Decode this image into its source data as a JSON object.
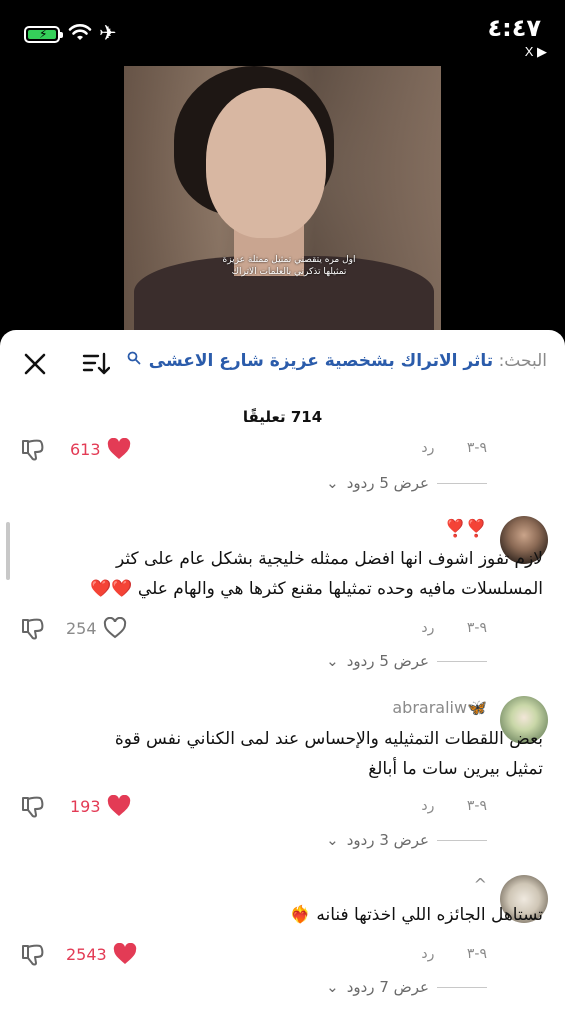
{
  "status_bar": {
    "time": "٤:٤٧",
    "back_app": "X ▶",
    "battery_icon": "battery-charging-icon",
    "wifi_icon": "wifi-icon",
    "airplane_icon": "airplane-icon"
  },
  "video": {
    "caption": "اول مره يتقصني تمثيل ممثلة عزيزة تمثيلها تذكرني بالعلمات الاتراك"
  },
  "search_bar": {
    "label": "البحث:",
    "query": "تاثر الاتراك بشخصية عزيزة شارع الاعشى",
    "close_icon": "close-icon",
    "sort_icon": "sort-icon",
    "search_icon": "search-icon"
  },
  "comments_count": "714 تعليقًا",
  "comments": [
    {
      "date": "٩-٣",
      "reply_label": "رد",
      "likes": "613",
      "liked": true,
      "view_replies": "عرض 5 ردود"
    },
    {
      "username": "",
      "prefix_emoji": "❣️❣️",
      "text": "لازم تفوز اشوف انها افضل ممثله خليجية بشكل عام على كثر المسلسلات مافيه وحده تمثيلها مقنع كثرها هي والهام علي ❤️❤️",
      "date": "٩-٣",
      "reply_label": "رد",
      "likes": "254",
      "liked": false,
      "view_replies": "عرض 5 ردود"
    },
    {
      "username": "abraraliw🦋",
      "text": "بعض اللقطات التمثيليه والإحساس عند لمى الكناني نفس قوة تمثيل بيرين سات ما أبالغ",
      "date": "٩-٣",
      "reply_label": "رد",
      "likes": "193",
      "liked": true,
      "view_replies": "عرض 3 ردود"
    },
    {
      "username": "^",
      "text": "تستاهل الجائزه اللي اخذتها فنانه ❤️‍🔥",
      "date": "٩-٣",
      "reply_label": "رد",
      "likes": "2543",
      "liked": true,
      "view_replies": "عرض 7 ردود"
    }
  ]
}
